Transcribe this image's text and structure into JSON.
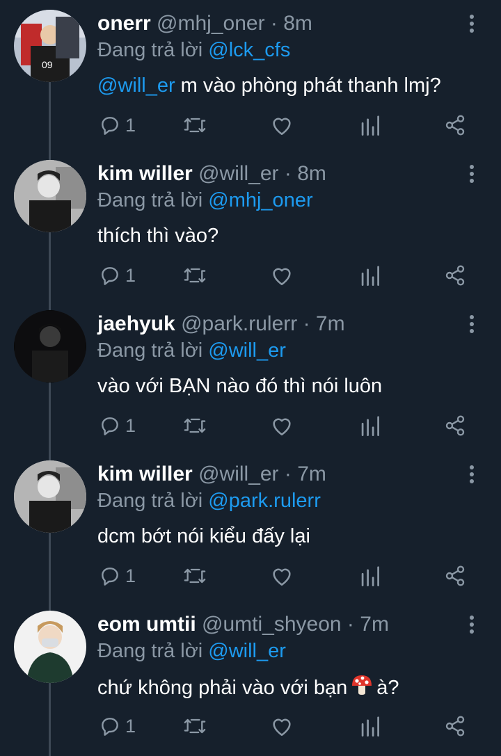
{
  "theme": {
    "background": "#16202c",
    "accent": "#1d9bf0",
    "muted": "#8b98a5",
    "thread_line": "#3d4855"
  },
  "tweets": [
    {
      "name": "onerr",
      "handle": "@mhj_oner",
      "time": "8m",
      "reply_prefix": "Đang trả lời",
      "reply_to": "@lck_cfs",
      "mention": "@will_er",
      "text": " m vào phòng phát thanh lmj?",
      "reply_count": "1",
      "avatar": "avatar-onerr"
    },
    {
      "name": "kim willer",
      "handle": "@will_er",
      "time": "8m",
      "reply_prefix": "Đang trả lời",
      "reply_to": "@mhj_oner",
      "mention": "",
      "text": "thích thì vào?",
      "reply_count": "1",
      "avatar": "avatar-kim-willer"
    },
    {
      "name": "jaehyuk",
      "handle": "@park.rulerr",
      "time": "7m",
      "reply_prefix": "Đang trả lời",
      "reply_to": "@will_er",
      "mention": "",
      "text": "vào với BẠN nào đó thì nói luôn",
      "reply_count": "1",
      "avatar": "avatar-jaehyuk"
    },
    {
      "name": "kim willer",
      "handle": "@will_er",
      "time": "7m",
      "reply_prefix": "Đang trả lời",
      "reply_to": "@park.rulerr",
      "mention": "",
      "text": "dcm bớt nói kiểu đấy lại",
      "reply_count": "1",
      "avatar": "avatar-kim-willer"
    },
    {
      "name": "eom umtii",
      "handle": "@umti_shyeon",
      "time": "7m",
      "reply_prefix": "Đang trả lời",
      "reply_to": "@will_er",
      "mention": "",
      "text": "chứ không phải vào với bạn",
      "text_after_emoji": "à?",
      "emoji": "mushroom-icon",
      "reply_count": "1",
      "avatar": "avatar-eom-umtii"
    }
  ],
  "sep": " · "
}
